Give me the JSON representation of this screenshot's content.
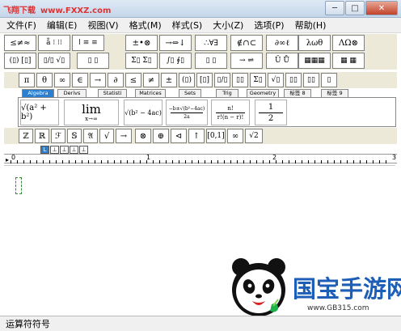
{
  "titlebar": {
    "site_name": "飞翔下载",
    "site_url": "www.FXXZ.com",
    "minimize": "─",
    "maximize": "□",
    "close": "✕"
  },
  "menu": [
    "文件(F)",
    "编辑(E)",
    "视图(V)",
    "格式(M)",
    "样式(S)",
    "大小(Z)",
    "选项(P)",
    "帮助(H)"
  ],
  "palette_row1": [
    "≤≠≈",
    "å ⁝ ⁝⁝",
    "ǀ ≡ ≡",
    "±•⊗",
    "→⇔↓",
    "∴∀∃",
    "∉∩⊂",
    "∂∞ℓ",
    "λωθ",
    "ΛΩ⊗"
  ],
  "palette_row2": [
    "(▯) [▯]",
    "▯/▯ √▯",
    "▯ ▯",
    "Σ▯ Σ▯",
    "∫▯ ∮▯",
    "▯ ▯",
    "→ ⇌",
    "Ū Ů",
    "▦▦▦",
    "▦ ▦"
  ],
  "palette_row3": [
    "π",
    "θ",
    "∞",
    "∈",
    "→",
    "∂",
    "≤",
    "≠",
    "±",
    "(▯)",
    "[▯]",
    "▯/▯",
    "▯▯",
    "Σ▯",
    "√▯",
    "▯▯",
    "▯▯",
    "▯"
  ],
  "tabs": [
    "Algebra",
    "Derivs",
    "Statisti",
    "Matrices",
    "Sets",
    "Trig",
    "Geometry",
    "标签 8",
    "标签 9"
  ],
  "templates": {
    "a": "√(a² + b²)",
    "lim": "lim",
    "lim_sub": "x→∞",
    "c": "√(b² − 4ac)",
    "d_num": "−b±√(b²−4ac)",
    "d_den": "2a",
    "e_num": "n!",
    "e_den": "r!(n − r)!",
    "f_num": "1",
    "f_den": "2"
  },
  "palette_row4": [
    "ℤ",
    "ℝ",
    "ℱ",
    "𝕊",
    "𝔄",
    "√",
    "→",
    "⊗",
    "⊕",
    "⊲",
    "↑",
    "[0,1]",
    "∞",
    "√2"
  ],
  "tabstops": [
    "L",
    "⊥",
    "⊥",
    "⊥",
    "⊥"
  ],
  "ruler_labels": [
    "0",
    "1",
    "2",
    "3"
  ],
  "watermark": {
    "text": "国宝手游网",
    "url": "www.GB315.com"
  },
  "status": "运算符符号"
}
